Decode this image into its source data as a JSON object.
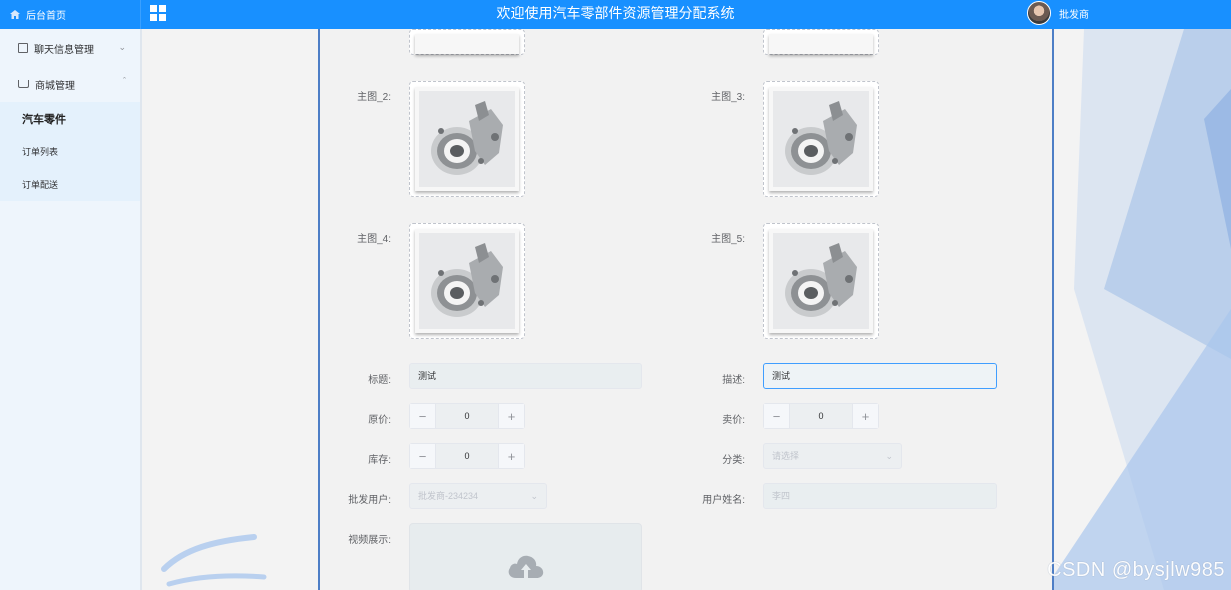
{
  "header": {
    "home_label": "后台首页",
    "title": "欢迎使用汽车零部件资源管理分配系统",
    "username": "批发商"
  },
  "sidebar": {
    "items": [
      {
        "label": "聊天信息管理",
        "expanded": false
      },
      {
        "label": "商城管理",
        "expanded": true
      }
    ],
    "subitems": [
      {
        "label": "汽车零件",
        "active": true
      },
      {
        "label": "订单列表",
        "active": false
      },
      {
        "label": "订单配送",
        "active": false
      }
    ]
  },
  "form": {
    "images": {
      "label_2": "主图_2:",
      "label_3": "主图_3:",
      "label_4": "主图_4:",
      "label_5": "主图_5:"
    },
    "title_label": "标题:",
    "title_value": "测试",
    "desc_label": "描述:",
    "desc_value": "测试",
    "orig_price_label": "原价:",
    "orig_price_value": "0",
    "sale_price_label": "卖价:",
    "sale_price_value": "0",
    "stock_label": "库存:",
    "stock_value": "0",
    "category_label": "分类:",
    "category_placeholder": "请选择",
    "wholesale_user_label": "批发用户:",
    "wholesale_user_value": "批发商-234234",
    "user_name_label": "用户姓名:",
    "user_name_value": "李四",
    "video_label": "视频展示:"
  },
  "watermark": "CSDN @bysjlw985",
  "icons": [
    "home-icon",
    "grid-menu-icon",
    "chat-icon",
    "cart-icon",
    "chevron-down-icon",
    "chevron-up-icon",
    "upload-cloud-icon"
  ],
  "colors": {
    "primary": "#1890ff",
    "sidebar_bg": "#eef5fc",
    "panel_border": "#4d7ec6",
    "focus": "#409eff"
  }
}
